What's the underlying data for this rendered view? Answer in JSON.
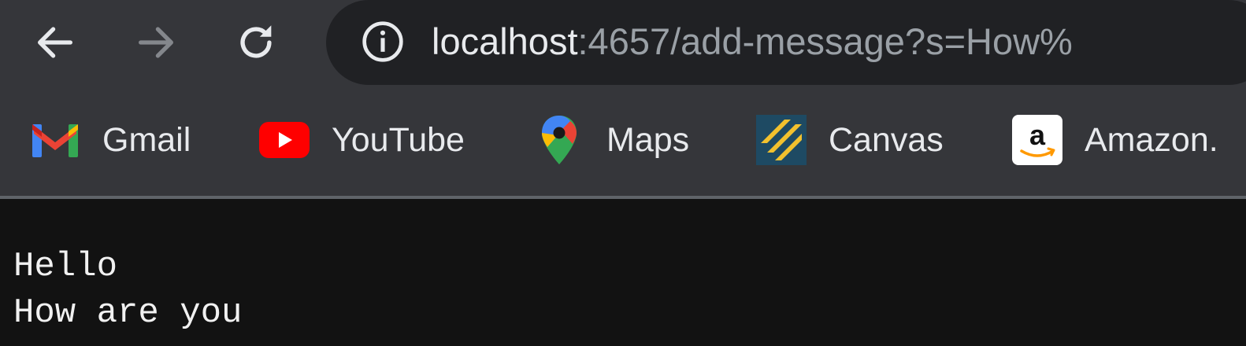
{
  "browser": {
    "url_host": "localhost",
    "url_rest": ":4657/add-message?s=How%"
  },
  "bookmarks": [
    {
      "label": "Gmail",
      "icon": "gmail-icon"
    },
    {
      "label": "YouTube",
      "icon": "youtube-icon"
    },
    {
      "label": "Maps",
      "icon": "maps-icon"
    },
    {
      "label": "Canvas",
      "icon": "canvas-icon"
    },
    {
      "label": "Amazon.",
      "icon": "amazon-icon"
    }
  ],
  "page": {
    "lines": [
      "Hello",
      "How are you"
    ]
  },
  "colors": {
    "toolbar": "#35363a",
    "omnibox": "#202124",
    "page_background": "#121212",
    "text": "#e8eaed"
  }
}
